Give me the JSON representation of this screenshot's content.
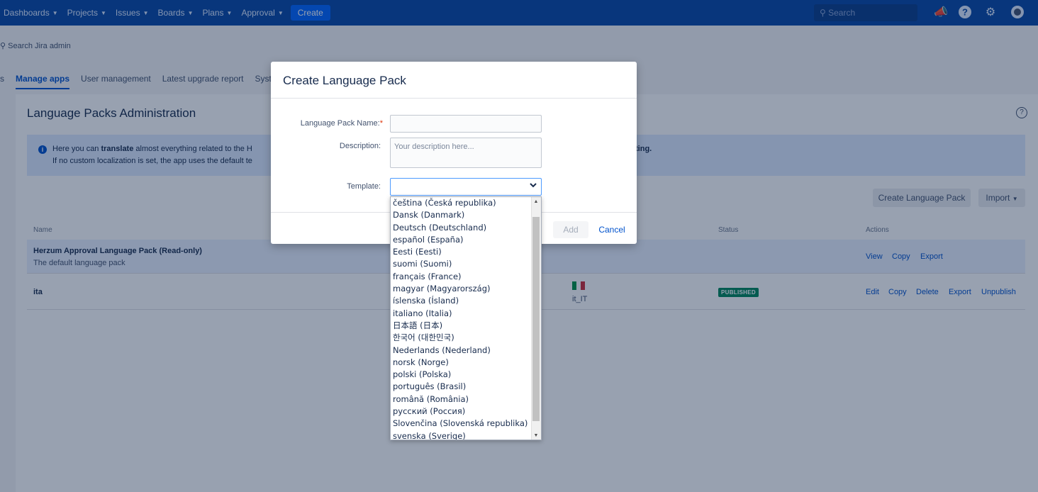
{
  "nav": {
    "items": [
      "Dashboards",
      "Projects",
      "Issues",
      "Boards",
      "Plans",
      "Approval"
    ],
    "create": "Create",
    "search_placeholder": "Search"
  },
  "admin": {
    "search": "Search Jira admin",
    "tabs": [
      "s",
      "Manage apps",
      "User management",
      "Latest upgrade report",
      "Syst"
    ]
  },
  "page": {
    "title": "Language Packs Administration",
    "info": {
      "line1_pre": "Here you can ",
      "line1_bold": "translate",
      "line1_post": " almost everything related to the H",
      "line1_tail": "ting.",
      "line2": "If no custom localization is set, the app uses the default te"
    },
    "create_button": "Create Language Pack",
    "import_button": "Import",
    "columns": {
      "name": "Name",
      "status": "Status",
      "actions": "Actions"
    },
    "rows": [
      {
        "name": "Herzum Approval Language Pack (Read-only)",
        "desc": "The default language pack",
        "locale": "",
        "status": "",
        "actions": [
          "View",
          "Copy",
          "Export"
        ]
      },
      {
        "name": "ita",
        "desc": "",
        "locale": "it_IT",
        "status": "PUBLISHED",
        "actions": [
          "Edit",
          "Copy",
          "Delete",
          "Export",
          "Unpublish"
        ]
      }
    ]
  },
  "modal": {
    "title": "Create Language Pack",
    "name_label": "Language Pack Name:",
    "required_mark": "*",
    "description_label": "Description:",
    "description_placeholder": "Your description here...",
    "template_label": "Template:",
    "add": "Add",
    "cancel": "Cancel"
  },
  "template_options": [
    "čeština (Česká republika)",
    "Dansk (Danmark)",
    "Deutsch (Deutschland)",
    "español (España)",
    "Eesti (Eesti)",
    "suomi (Suomi)",
    "français (France)",
    "magyar (Magyarország)",
    "íslenska (Ísland)",
    "italiano (Italia)",
    "日本語 (日本)",
    "한국어 (대한민국)",
    "Nederlands (Nederland)",
    "norsk (Norge)",
    "polski (Polska)",
    "português (Brasil)",
    "română (România)",
    "русский (Россия)",
    "Slovenčina (Slovenská republika)",
    "svenska (Sverige)"
  ]
}
